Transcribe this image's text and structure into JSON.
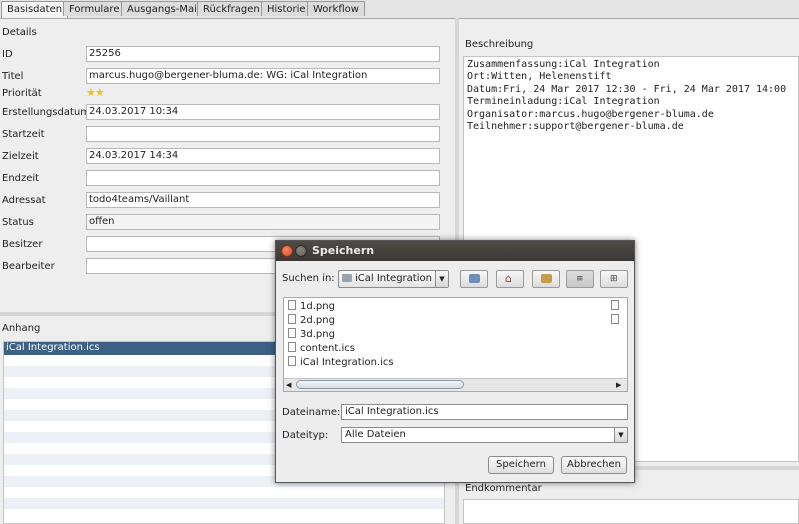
{
  "tabs": [
    "Basisdaten",
    "Formulare",
    "Ausgangs-Mail",
    "Rückfragen",
    "Historie",
    "Workflow"
  ],
  "details": {
    "section_title": "Details",
    "fields": {
      "id": {
        "label": "ID",
        "value": "25256"
      },
      "titel": {
        "label": "Titel",
        "value": "marcus.hugo@bergener-bluma.de: WG: iCal Integration"
      },
      "prioritaet": {
        "label": "Priorität",
        "stars": 2
      },
      "erstellungsdatum": {
        "label": "Erstellungsdatum",
        "value": "24.03.2017 10:34"
      },
      "startzeit": {
        "label": "Startzeit",
        "value": ""
      },
      "zielzeit": {
        "label": "Zielzeit",
        "value": "24.03.2017 14:34"
      },
      "endzeit": {
        "label": "Endzeit",
        "value": ""
      },
      "adressat": {
        "label": "Adressat",
        "value": "todo4teams/Vaillant"
      },
      "status": {
        "label": "Status",
        "value": "offen"
      },
      "besitzer": {
        "label": "Besitzer",
        "value": ""
      },
      "bearbeiter": {
        "label": "Bearbeiter",
        "value": ""
      }
    }
  },
  "anhang": {
    "section_title": "Anhang",
    "selected_item": "iCal Integration.ics"
  },
  "beschreibung": {
    "section_title": "Beschreibung",
    "lines": [
      "Zusammenfassung:iCal Integration",
      "Ort:Witten, Helenenstift",
      "Datum:Fri, 24 Mar 2017 12:30 - Fri, 24 Mar 2017 14:00",
      "Termineinladung:iCal Integration",
      "Organisator:marcus.hugo@bergener-bluma.de",
      "Teilnehmer:support@bergener-bluma.de"
    ]
  },
  "endkommentar": {
    "section_title": "Endkommentar"
  },
  "dialog": {
    "title": "Speichern",
    "look_in_label": "Suchen in:",
    "look_in_value": "iCal Integration",
    "files": [
      "1d.png",
      "2d.png",
      "3d.png",
      "content.ics",
      "iCal Integration.ics"
    ],
    "filename_label": "Dateiname:",
    "filename_value": "iCal Integration.ics",
    "filetype_label": "Dateityp:",
    "filetype_value": "Alle Dateien",
    "save_button": "Speichern",
    "cancel_button": "Abbrechen"
  },
  "colors": {
    "accent_selection": "#3d6185",
    "titlebar": "#3f3c38",
    "close_button": "#e25c34",
    "star": "#f0c020"
  }
}
